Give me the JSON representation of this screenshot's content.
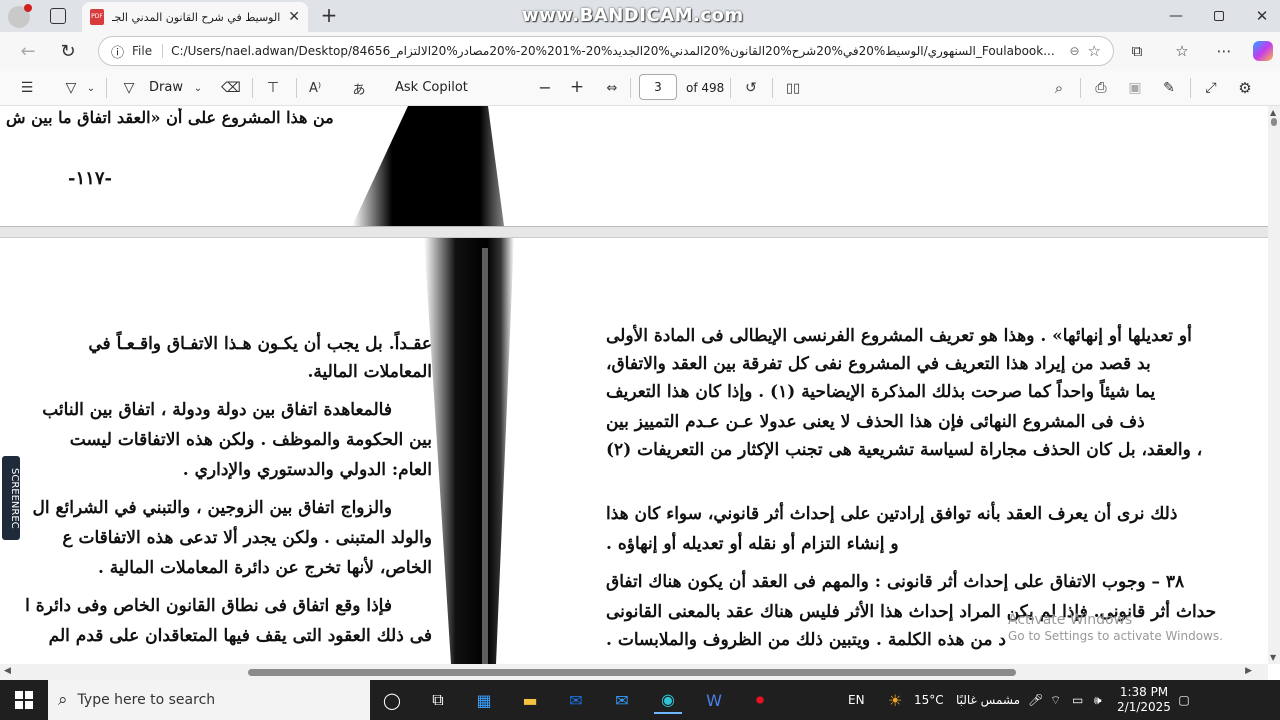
{
  "browser": {
    "tab_title": "الوسيط في شرح القانون المدني الجـ",
    "new_tab": "+",
    "watermark": "www.BANDICAM.com",
    "address_label": "File",
    "url": "C:/Users/nael.adwan/Desktop/84656_السنهوري/الوسيط%20في%20شرح%20القانون%20المدني%20الجديد%20-%201%20-%20مصادر%20الالتزام_Foulabook..."
  },
  "pdf_toolbar": {
    "draw_label": "Draw",
    "copilot_label": "Ask Copilot",
    "page_current": "3",
    "page_total": "of 498",
    "zoom_out": "−",
    "zoom_in": "+"
  },
  "document": {
    "top_left_line": "من هذا المشروع على أن «العقد اتفاق ما بين ش",
    "page_number": "-١١٧-",
    "left_column": [
      "عقـداً. بل يجب أن يكـون هـذا الاتفـاق واقـعـاً في",
      "المعاملات المالية.",
      "فالمعاهدة اتفاق بين دولة ودولة ، اتفاق بين النائب",
      "بين الحكومة والموظف . ولكن هذه الاتفاقات ليست",
      "العام: الدولي والدستوري والإداري .",
      "والزواج اتفاق بين الزوجين ، والتبني في الشرائع ال",
      "والولد المتبنى . ولكن يجدر ألا تدعى هذه الاتفاقات ع",
      "الخاص، لأنها تخرج عن دائرة المعاملات المالية .",
      "فإذا وقع اتفاق فى نطاق القانون الخاص وفى دائرة ا",
      "فى ذلك العقود التى يقف فيها المتعاقدان على قدم الم"
    ],
    "right_column": [
      "أو تعديلها أو إنهائها» . وهذا هو تعريف المشروع الفرنسى الإيطالى فى المادة الأولى",
      "بد قصد من إيراد هذا التعريف في المشروع نفى كل تفرقة بين العقد والاتفاق،",
      "يما شيئاً واحداً كما صرحت بذلك المذكرة الإيضاحية (١) . وإذا كان هذا التعريف",
      "ذف فى المشروع النهائى فإن هذا الحذف لا يعنى عدولا عـن عـدم التمييز بين",
      "، والعقد، بل كان الحذف مجاراة لسياسة تشريعية هى تجنب الإكثار من التعريفات (٢)",
      "ذلك نرى أن يعرف العقد بأنه توافق إرادتين على إحداث أثر قانوني، سواء كان هذا",
      "و إنشاء التزام أو نقله أو تعديله أو إنهاؤه .",
      "٣٨ – وجوب الاتفاق على إحداث أثر قانونى : والمهم فى العقد أن يكون هناك اتفاق",
      "حداث أثر قانونى. فإذا لم يكن المراد إحداث هذا الأثر فليس هناك عقد بالمعنى القانونى",
      "د من هذه الكلمة . ويتبين ذلك من الظروف والملابسات ."
    ],
    "activate_windows_1": "Activate Windows",
    "activate_windows_2": "Go to Settings to activate Windows.",
    "screenrec_label": "SCREENREC"
  },
  "taskbar": {
    "search_placeholder": "Type here to search",
    "language": "EN",
    "weather": "15°C",
    "weather_desc": "مشمس غالبًا",
    "time": "1:38 PM",
    "date": "2/1/2025"
  },
  "colors": {
    "accent": "#0067c0",
    "record": "#e81123",
    "taskbar": "#1f1f1f"
  }
}
